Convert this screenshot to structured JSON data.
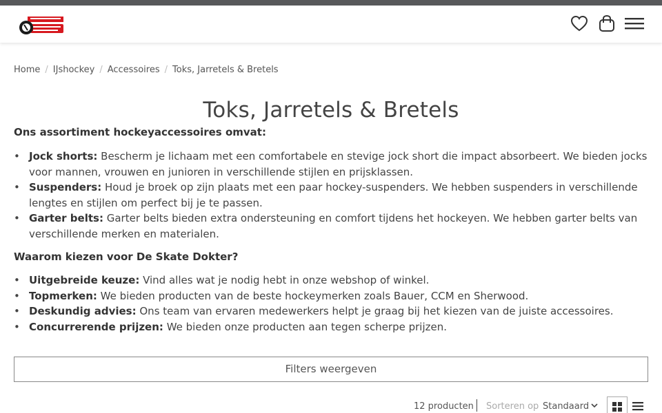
{
  "header": {
    "logo_alt": "De Skate Dokter",
    "wishlist_icon": "heart-icon",
    "cart_icon": "shopping-bag-icon",
    "menu_icon": "hamburger-menu-icon"
  },
  "breadcrumb": {
    "items": [
      "Home",
      "IJshockey",
      "Accessoires",
      "Toks, Jarretels & Bretels"
    ],
    "separator": "/"
  },
  "page": {
    "title": "Toks, Jarretels & Bretels",
    "intro": "Ons assortiment hockeyaccessoires omvat:",
    "list1": [
      {
        "term": "Jock shorts:",
        "text": " Bescherm je lichaam met een comfortabele en stevige jock short die impact absorbeert. We bieden jocks voor mannen, vrouwen en junioren in verschillende stijlen en prijsklassen."
      },
      {
        "term": "Suspenders:",
        "text": " Houd je broek op zijn plaats met een paar hockey-suspenders. We hebben suspenders in verschillende lengtes en stijlen om perfect bij je te passen."
      },
      {
        "term": "Garter belts:",
        "text": " Garter belts bieden extra ondersteuning en comfort tijdens het hockeyen. We hebben garter belts van verschillende merken en materialen."
      }
    ],
    "question": "Waarom kiezen voor De Skate Dokter?",
    "list2": [
      {
        "term": "Uitgebreide keuze:",
        "text": " Vind alles wat je nodig hebt in onze webshop of winkel."
      },
      {
        "term": "Topmerken:",
        "text": " We bieden producten van de beste hockeymerken zoals Bauer, CCM en Sherwood."
      },
      {
        "term": "Deskundig advies:",
        "text": " Ons team van ervaren medewerkers helpt je graag bij het kiezen van de juiste accessoires."
      },
      {
        "term": "Concurrerende prijzen:",
        "text": " We bieden onze producten aan tegen scherpe prijzen."
      }
    ]
  },
  "filters": {
    "label": "Filters weergeven"
  },
  "toolbar": {
    "count": "12 producten",
    "sort_label": "Sorteren op",
    "sort_value": "Standaard",
    "grid_icon": "grid-view-icon",
    "list_icon": "list-view-icon"
  },
  "colors": {
    "topbar": "#58595b",
    "logo_red": "#d71920",
    "text": "#444444"
  }
}
